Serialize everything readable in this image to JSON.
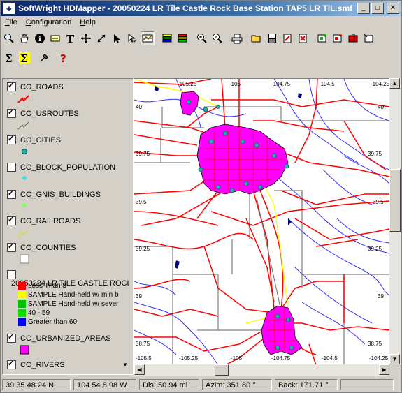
{
  "window": {
    "title": "SoftWright HDMapper - 20050224 LR Tile Castle Rock Base Station TAP5 LR TIL.smf",
    "app_icon": "map-app-icon",
    "minimize_icon": "minimize-icon",
    "maximize_icon": "maximize-icon",
    "close_icon": "close-icon"
  },
  "menu": [
    {
      "label": "File",
      "key": "F",
      "rest": "ile"
    },
    {
      "label": "Configuration",
      "key": "C",
      "rest": "onfiguration"
    },
    {
      "label": "Help",
      "key": "H",
      "rest": "elp"
    }
  ],
  "toolbar_row1": [
    "zoom-icon",
    "pan-hand-icon",
    "info-icon",
    "label-tool-icon",
    "text-tool-icon",
    "move-cross-icon",
    "measure-line-icon",
    "select-arrow-icon",
    "select-edit-icon",
    "map-view-icon",
    "layers-icon",
    "layers-alt-icon",
    "zoom-in-icon",
    "zoom-out-icon",
    "print-icon",
    "open-folder-icon",
    "save-icon",
    "edit-doc-icon",
    "delete-doc-icon",
    "add-layer-icon",
    "remove-layer-icon",
    "export-icon",
    "properties-icon"
  ],
  "toolbar_row2": [
    "sigma-icon",
    "sigma-highlight-icon",
    "tools-icon",
    "help-icon"
  ],
  "layers": [
    {
      "name": "CO_ROADS",
      "checked": true
    },
    {
      "name": "CO_USROUTES",
      "checked": true
    },
    {
      "name": "CO_CITIES",
      "checked": true
    },
    {
      "name": "CO_BLOCK_POPULATION",
      "checked": false
    },
    {
      "name": "CO_GNIS_BUILDINGS",
      "checked": true
    },
    {
      "name": "CO_RAILROADS",
      "checked": true
    },
    {
      "name": "CO_COUNTIES",
      "checked": true
    },
    {
      "name": "20050224 LR TILE CASTLE ROCI",
      "checked": false
    },
    {
      "name": "CO_URBANIZED_AREAS",
      "checked": true
    },
    {
      "name": "CO_RIVERS",
      "checked": true
    }
  ],
  "signal_legend": [
    {
      "label": "Less Than 8",
      "color": "#ff0000"
    },
    {
      "label": "SAMPLE Hand-held w/ min b",
      "color": "#ffff00"
    },
    {
      "label": "SAMPLE Hand-held w/ sever",
      "color": "#00c000"
    },
    {
      "label": "40 - 59",
      "color": "#00e000"
    },
    {
      "label": "Greater than 60",
      "color": "#0000ff"
    }
  ],
  "map": {
    "lon_labels": [
      "-105",
      "-104.75",
      "-104.5",
      "-104.25"
    ],
    "lon_labels_bottom": [
      "-105.5",
      "-105.25",
      "-105",
      "-104.75",
      "-104.5",
      "-104.25"
    ],
    "lat_labels": [
      "40",
      "39.75",
      "39.5",
      "39.25",
      "39",
      "38.75"
    ],
    "top_labels": [
      "-105.25",
      "-105",
      "-104.75",
      "-104.5",
      "-104.25"
    ],
    "colors": {
      "roads": "#ff0000",
      "routes": "#e00000",
      "rivers": "#3030ff",
      "counties": "#808080",
      "urban": "#ff00ff",
      "cities": "#20b0b0",
      "railroads": "#ffff00"
    }
  },
  "status": {
    "latitude": "39 35 48.24 N",
    "longitude": "104 54 8.98 W",
    "distance": "Dis: 50.94 mi",
    "azimuth": "Azim: 351.80 °",
    "back_azimuth": "Back: 171.71 °"
  }
}
